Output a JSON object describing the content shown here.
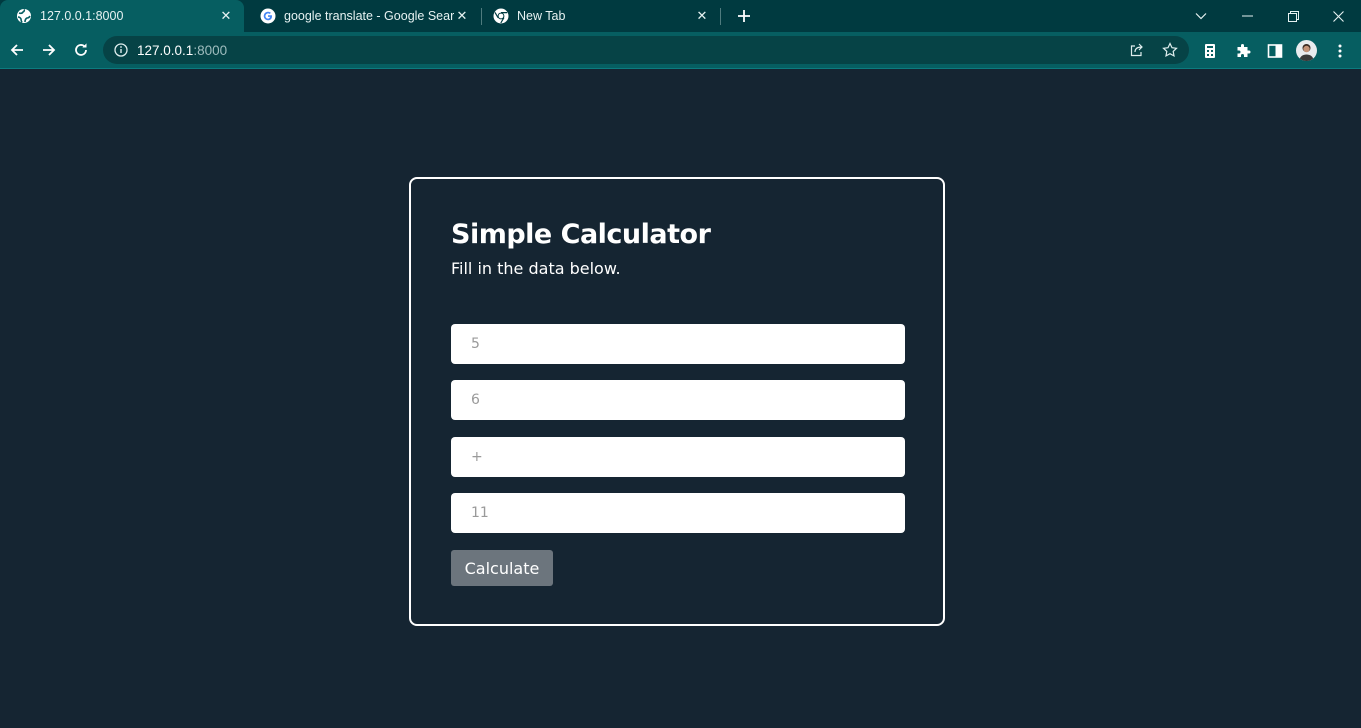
{
  "browser": {
    "tabs": [
      {
        "title": "127.0.0.1:8000",
        "favicon": "globe-icon",
        "active": true
      },
      {
        "title": "google translate - Google Search",
        "favicon": "google-g-icon",
        "active": false
      },
      {
        "title": "New Tab",
        "favicon": "chrome-icon",
        "active": false
      }
    ],
    "address": {
      "host": "127.0.0.1",
      "port": ":8000"
    },
    "colors": {
      "tabstrip": "#003a40",
      "toolbar": "#065e61",
      "omnibox": "#064346"
    }
  },
  "calculator": {
    "title": "Simple Calculator",
    "subtitle": "Fill in the data below.",
    "fields": [
      {
        "placeholder": "5"
      },
      {
        "placeholder": "6"
      },
      {
        "placeholder": "+"
      },
      {
        "placeholder": "11"
      }
    ],
    "button_label": "Calculate",
    "colors": {
      "background": "#152532",
      "button": "#6c757d",
      "field": "#ffffff",
      "border": "#ffffff"
    }
  }
}
